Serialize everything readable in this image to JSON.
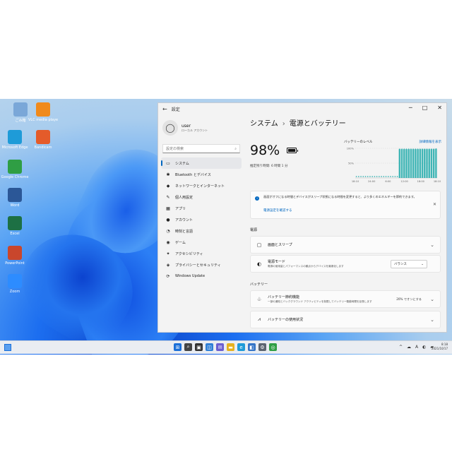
{
  "desktop": {
    "icons": [
      {
        "name": "ごみ箱",
        "icon": "recycle-bin-icon",
        "color": "#7aa7d8"
      },
      {
        "name": "VLC media player",
        "icon": "vlc-icon",
        "color": "#f08a1c"
      },
      {
        "name": "Microsoft Edge",
        "icon": "edge-icon",
        "color": "#1e9bd8"
      },
      {
        "name": "Bandicam",
        "icon": "app-icon",
        "color": "#e45b2a"
      },
      {
        "name": "Google Chrome",
        "icon": "chrome-icon",
        "color": "#2f9e44"
      },
      {
        "name": "Word",
        "icon": "word-icon",
        "color": "#2b5797"
      },
      {
        "name": "Excel",
        "icon": "excel-icon",
        "color": "#1d7044"
      },
      {
        "name": "PowerPoint",
        "icon": "powerpoint-icon",
        "color": "#c9462c"
      },
      {
        "name": "Zoom",
        "icon": "zoom-icon",
        "color": "#2d8cff"
      }
    ]
  },
  "window": {
    "title": "設定",
    "controls": {
      "minimize": "─",
      "maximize": "□",
      "close": "✕"
    }
  },
  "sidebar": {
    "user_name": "user",
    "user_sub": "ローカル アカウント",
    "search_placeholder": "設定の検索",
    "items": [
      {
        "label": "システム",
        "icon": "monitor-icon",
        "glyph": "▭",
        "selected": true
      },
      {
        "label": "Bluetooth とデバイス",
        "icon": "bluetooth-icon",
        "glyph": "✱"
      },
      {
        "label": "ネットワークとインターネット",
        "icon": "network-icon",
        "glyph": "◆"
      },
      {
        "label": "個人用設定",
        "icon": "brush-icon",
        "glyph": "✎"
      },
      {
        "label": "アプリ",
        "icon": "apps-icon",
        "glyph": "▦"
      },
      {
        "label": "アカウント",
        "icon": "account-icon",
        "glyph": "●"
      },
      {
        "label": "時刻と言語",
        "icon": "clock-globe-icon",
        "glyph": "◔"
      },
      {
        "label": "ゲーム",
        "icon": "game-icon",
        "glyph": "◉"
      },
      {
        "label": "アクセシビリティ",
        "icon": "accessibility-icon",
        "glyph": "✦"
      },
      {
        "label": "プライバシーとセキュリティ",
        "icon": "shield-icon",
        "glyph": "◈"
      },
      {
        "label": "Windows Update",
        "icon": "update-icon",
        "glyph": "⟳"
      }
    ]
  },
  "content": {
    "breadcrumb_parent": "システム",
    "breadcrumb_sep": "›",
    "breadcrumb_current": "電源とバッテリー",
    "battery_percent": "98%",
    "battery_sub": "推定残り時間: 6 時間 1 分",
    "info_text": "画面がオフになる時間とデバイスがスリープ状態になる時間を変更すると、より多くのエネルギーを節約できます。",
    "info_link": "電源設定を確認する",
    "section_power": "電源",
    "row_sleep": "画面とスリープ",
    "row_mode_title": "電源モード",
    "row_mode_sub": "電源の使用量とパフォーマンスの観点からデバイスを最適化します",
    "row_mode_value": "バランス",
    "section_battery": "バッテリー",
    "row_saver_title": "バッテリー節約機能",
    "row_saver_sub": "一部の通知とバックグラウンド アクティビティを制限してバッテリー駆動時間を延長します",
    "row_saver_value": "20% でオンにする",
    "row_usage": "バッテリーの使用状況"
  },
  "chart_data": {
    "type": "bar",
    "title": "バッテリーのレベル",
    "link": "詳細情報を表示",
    "ylim": [
      0,
      100
    ],
    "y_ticks": [
      "100%",
      "50%"
    ],
    "x_ticks": [
      "18:10",
      "24:00",
      "6:00",
      "12:00",
      "18:00",
      "18:10"
    ],
    "values": [
      2,
      2,
      2,
      2,
      2,
      2,
      2,
      2,
      2,
      2,
      2,
      2,
      2,
      2,
      2,
      2,
      2,
      2,
      2,
      97,
      97,
      97,
      97,
      97,
      97,
      97,
      97,
      97,
      97,
      97,
      97,
      97,
      97,
      97,
      97,
      98
    ],
    "bar_color": "#3fb5b5",
    "axis_text_color": "#666666"
  },
  "taskbar": {
    "items": [
      {
        "icon": "start-icon",
        "glyph": "⊞",
        "color": "#1b6fd8"
      },
      {
        "icon": "search-icon",
        "glyph": "⌕",
        "color": "#444444"
      },
      {
        "icon": "task-view-icon",
        "glyph": "▣",
        "color": "#333333"
      },
      {
        "icon": "widgets-icon",
        "glyph": "◫",
        "color": "#2f7fd6"
      },
      {
        "icon": "chat-icon",
        "glyph": "✉",
        "color": "#6b5fd1"
      },
      {
        "icon": "file-explorer-icon",
        "glyph": "▬",
        "color": "#e6b21e"
      },
      {
        "icon": "edge-icon",
        "glyph": "e",
        "color": "#1f9bd8"
      },
      {
        "icon": "store-icon",
        "glyph": "◧",
        "color": "#3474c6"
      },
      {
        "icon": "settings-icon",
        "glyph": "⚙",
        "color": "#5b6470"
      },
      {
        "icon": "chrome-icon",
        "glyph": "◎",
        "color": "#2f9e44"
      }
    ],
    "tray": [
      "^",
      "☁",
      "A",
      "◐",
      "▰"
    ],
    "clock_time": "8:18",
    "clock_date": "2021/10/17"
  }
}
